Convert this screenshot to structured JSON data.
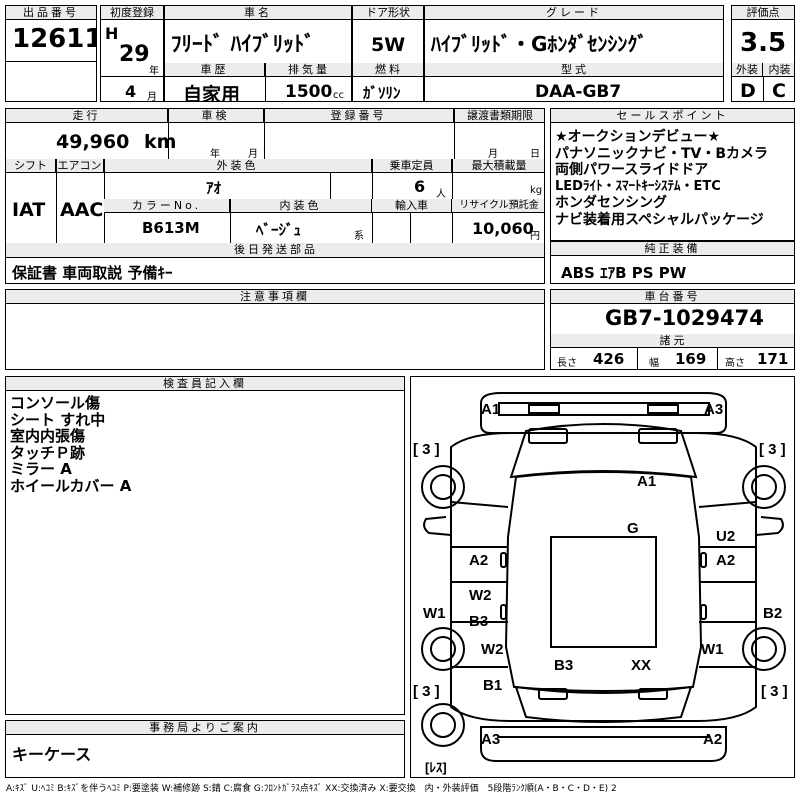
{
  "headers": {
    "lot_no": "出品番号",
    "first_reg": "初度登録",
    "car_name": "車名",
    "door": "ドア形状",
    "grade": "グレード",
    "score": "評価点",
    "history": "車歴",
    "displacement": "排気量",
    "fuel": "燃料",
    "model": "型式",
    "exterior": "外装",
    "interior": "内装",
    "mileage": "走行",
    "inspection": "車検",
    "reg_no": "登録番号",
    "transfer": "譲渡書類期限",
    "sales_point": "セールスポイント",
    "shift": "シフト",
    "ac": "エアコン",
    "ext_color": "外装色",
    "capacity": "乗車定員",
    "max_load": "最大積載量",
    "color_no": "カラーNo.",
    "int_color": "内装色",
    "import": "輸入車",
    "recycle": "リサイクル預託金",
    "later_parts": "後日発送部品",
    "equipment": "純正装備",
    "notes": "注意事項欄",
    "chassis": "車台番号",
    "dims": "諸元",
    "inspector": "検査員記入欄",
    "office": "事務局よりご案内"
  },
  "lot_no": "12611",
  "first_reg": {
    "era": "H",
    "year": "29",
    "year_unit": "年",
    "month": "4",
    "month_unit": "月"
  },
  "car_name": "ﾌﾘｰﾄﾞ ﾊｲﾌﾞﾘｯﾄﾞ",
  "door": "5W",
  "grade": "ﾊｲﾌﾞﾘｯﾄﾞ・Gﾎﾝﾀﾞｾﾝｼﾝｸﾞ",
  "score": "3.5",
  "history": "自家用",
  "displacement": "1500",
  "displacement_unit": "cc",
  "fuel": "ｶﾞｿﾘﾝ",
  "model": "DAA-GB7",
  "exterior_grade": "D",
  "interior_grade": "C",
  "mileage": "49,960",
  "mileage_unit": "km",
  "inspection_units": {
    "year": "年",
    "month": "月"
  },
  "transfer_units": {
    "month": "月",
    "day": "日"
  },
  "shift": "IAT",
  "ac": "AAC",
  "ext_color": "ｱｵ",
  "capacity": "6",
  "capacity_unit": "人",
  "max_load_unit": "kg",
  "color_no": "B613M",
  "int_color": "ﾍﾞｰｼﾞｭ",
  "int_color_suffix": "系",
  "recycle": "10,060",
  "recycle_unit": "円",
  "sales_points": [
    "★オークションデビュー★",
    "パナソニックナビ・TV・Bカメラ",
    "両側パワースライドドア",
    "LEDﾗｲﾄ・ｽﾏｰﾄｷｰｼｽﾃﾑ・ETC",
    "ホンダセンシング",
    "ナビ装着用スペシャルパッケージ"
  ],
  "later_parts": "保証書 車両取説 予備ｷｰ",
  "equipment": "ABS ｴｱB PS PW",
  "chassis": "GB7-1029474",
  "dims": {
    "length_label": "長さ",
    "length": "426",
    "width_label": "幅",
    "width": "169",
    "height_label": "高さ",
    "height": "171"
  },
  "inspector_notes": [
    "コンソール傷",
    "シート すれ中",
    "室内内張傷",
    "タッチＰ跡",
    "ミラー A",
    "ホイールカバー A"
  ],
  "office_note": "キーケース",
  "diagram_marks": {
    "front_left": "A1",
    "front_right": "A3",
    "hood": "A1",
    "roof": "G",
    "left_front_door": "A2",
    "right_front": "U2",
    "right_front_door": "A2",
    "left_mid": "W2",
    "left_rear_door": "B3",
    "left_fender_front": "W1",
    "right_fender_front": "B2",
    "left_rear": "W2",
    "tailgate_left": "B3",
    "tailgate_right": "XX",
    "right_rear": "W1",
    "left_quarter": "B1",
    "rear_left": "A3",
    "rear_right": "A2",
    "tire_fl": "[ 3 ]",
    "tire_fr": "[ 3 ]",
    "tire_rl": "[ 3 ]",
    "tire_rr": "[ 3 ]",
    "spare": "[ﾚｽ]"
  },
  "legend": "A:ｷｽﾞ U:ﾍｺﾐ B:ｷｽﾞを伴うﾍｺﾐ P:要塗装 W:補修跡 S:錆 C:腐食 G:ﾌﾛﾝﾄｶﾞﾗｽ点ｷｽﾞ XX:交換済み X:要交換　内・外装評価　5段階ﾗﾝｸ順(A・B・C・D・E) 2"
}
